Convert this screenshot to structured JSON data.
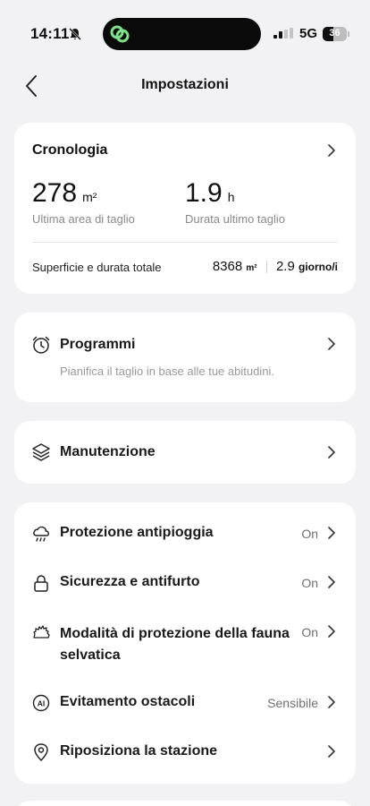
{
  "status_bar": {
    "time": "14:11",
    "network": "5G",
    "battery": "36"
  },
  "header": {
    "title": "Impostazioni"
  },
  "history": {
    "title": "Cronologia",
    "last_area_value": "278",
    "last_area_unit": "m²",
    "last_area_label": "Ultima area di taglio",
    "last_duration_value": "1.9",
    "last_duration_unit": "h",
    "last_duration_label": "Durata ultimo taglio",
    "total_label": "Superficie e durata totale",
    "total_area_value": "8368",
    "total_area_unit": "m²",
    "total_days_value": "2.9",
    "total_days_unit": "giorno/i"
  },
  "schedule": {
    "title": "Programmi",
    "subtitle": "Pianifica il taglio in base alle tue abitudini."
  },
  "maintenance": {
    "title": "Manutenzione"
  },
  "settings_list": {
    "rain": {
      "label": "Protezione antipioggia",
      "value": "On"
    },
    "security": {
      "label": "Sicurezza e antifurto",
      "value": "On"
    },
    "wildlife": {
      "label_line1": "Modalità di protezione della fauna",
      "label_line2": "selvatica",
      "value": "On"
    },
    "obstacle": {
      "label": "Evitamento ostacoli",
      "value": "Sensibile"
    },
    "station": {
      "label": "Riposiziona la stazione"
    }
  },
  "icons": {
    "back": "chevron-left-icon",
    "chevron": "chevron-right-icon",
    "schedule": "alarm-clock-icon",
    "maintenance": "layers-icon",
    "rain": "rain-cloud-icon",
    "security": "lock-icon",
    "wildlife": "hedgehog-icon",
    "obstacle": "ai-circle-icon",
    "station": "location-pin-icon"
  }
}
